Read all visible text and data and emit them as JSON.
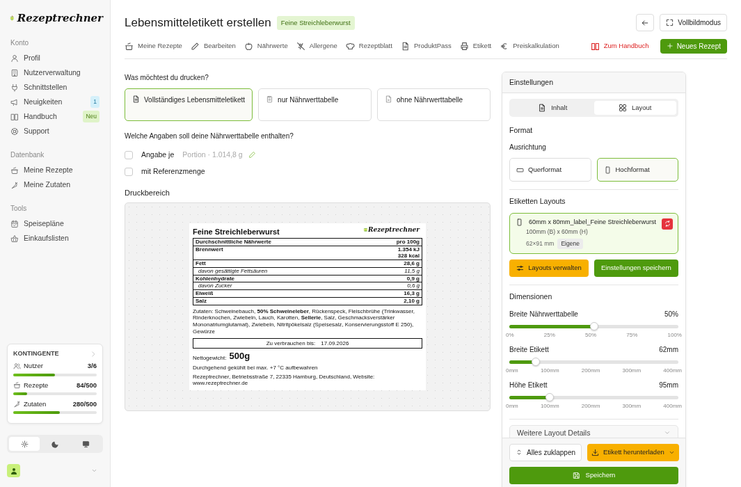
{
  "logo": {
    "name": "Rezeptrechner"
  },
  "sidebar": {
    "sections": [
      {
        "title": "Konto",
        "items": [
          {
            "label": "Profil"
          },
          {
            "label": "Nutzerverwaltung"
          },
          {
            "label": "Schnittstellen"
          },
          {
            "label": "Neuigkeiten",
            "badge": "1",
            "kind": "info"
          },
          {
            "label": "Handbuch",
            "badge": "Neu",
            "kind": "new"
          },
          {
            "label": "Support"
          }
        ]
      },
      {
        "title": "Datenbank",
        "items": [
          {
            "label": "Meine Rezepte"
          },
          {
            "label": "Meine Zutaten"
          }
        ]
      },
      {
        "title": "Tools",
        "items": [
          {
            "label": "Speisepläne"
          },
          {
            "label": "Einkaufslisten"
          }
        ]
      }
    ]
  },
  "quota": {
    "title": "KONTINGENTE",
    "items": [
      {
        "label": "Nutzer",
        "value": "3/6",
        "level": 0.5
      },
      {
        "label": "Rezepte",
        "value": "84/500",
        "level": 0.168
      },
      {
        "label": "Zutaten",
        "value": "280/500",
        "level": 0.56
      }
    ]
  },
  "theme_switch": [
    {
      "kind": "light",
      "selected": true
    },
    {
      "kind": "dark",
      "selected": false
    },
    {
      "kind": "system",
      "selected": false
    }
  ],
  "header": {
    "title": "Lebensmitteletikett erstellen",
    "tag": "Feine Streichleberwurst",
    "fullscreen_button": "Vollbildmodus"
  },
  "nav": {
    "items": [
      {
        "label": "Meine Rezepte"
      },
      {
        "label": "Bearbeiten"
      },
      {
        "label": "Nährwerte"
      },
      {
        "label": "Allergene"
      },
      {
        "label": "Rezeptblatt"
      },
      {
        "label": "ProduktPass"
      },
      {
        "label": "Etikett"
      },
      {
        "label": "Preiskalkulation"
      }
    ],
    "handbook_link": "Zum Handbuch",
    "new_button": "Neues Rezept"
  },
  "print_options": {
    "question": "Was möchtest du drucken?",
    "options": [
      {
        "label": "Vollständiges Lebensmitteletikett",
        "selected": true
      },
      {
        "label": "nur Nährwerttabelle",
        "selected": false
      },
      {
        "label": "ohne Nährwerttabelle",
        "selected": false
      }
    ]
  },
  "nutrition_options": {
    "question": "Welche Angaben soll deine Nährwerttabelle enthalten?",
    "checks": [
      {
        "label": "Angabe je",
        "detail": "Portion · 1.014,8 g",
        "checked": false
      },
      {
        "label": "mit Referenzmenge",
        "checked": false
      }
    ]
  },
  "print_area": {
    "title": "Druckbereich",
    "label": {
      "title": "Feine Streichleberwurst",
      "brand": "Rezeptrechner",
      "table_head": [
        "Durchschnittliche Nährwerte",
        "pro 100g"
      ],
      "rows": [
        {
          "name": "Brennwert",
          "values": [
            "1.354 kJ",
            "328 kcal"
          ],
          "kind": "main"
        },
        {
          "name": "Fett",
          "values": [
            "28,6 g"
          ],
          "kind": "main"
        },
        {
          "name": "davon gesättigte Fettsäuren",
          "values": [
            "11,5 g"
          ],
          "kind": "sub"
        },
        {
          "name": "Kohlenhydrate",
          "values": [
            "0,9 g"
          ],
          "kind": "main"
        },
        {
          "name": "davon Zucker",
          "values": [
            "0,6 g"
          ],
          "kind": "sub"
        },
        {
          "name": "Eiweiß",
          "values": [
            "16,3 g"
          ],
          "kind": "main"
        },
        {
          "name": "Salz",
          "values": [
            "2,10 g"
          ],
          "kind": "main"
        }
      ],
      "ingredients": "Zutaten: Schweinebauch, **50% Schweineleber**, Rückenspeck, Fleischbrühe (Trinkwasser, Rinderknochen, Zwiebeln, Lauch, Karotten, **Sellerie**, Salz, Geschmacksverstärker Mononatriumglutamat), Zwiebeln, Nitritpökelsalz (Speisesalz, Konservierungsstoff E 250), Gewürze",
      "best_before_label": "Zu verbrauchen bis:",
      "best_before": "17.09.2026",
      "net_label": "Nettogewicht:",
      "net_value": "500g",
      "storage": "Durchgehend gekühlt bei max. +7 °C aufbewahren",
      "address": "Rezeptrechner, Betriebsstraße 7, 22335 Hamburg, Deutschland, Website: www.rezeptrechner.de"
    }
  },
  "settings": {
    "title": "Einstellungen",
    "tabs": [
      {
        "label": "Inhalt",
        "selected": false
      },
      {
        "label": "Layout",
        "selected": true
      }
    ],
    "format_title": "Format",
    "orientation_label": "Ausrichtung",
    "orientations": [
      {
        "label": "Querformat",
        "selected": false
      },
      {
        "label": "Hochformat",
        "selected": true
      }
    ],
    "layouts_title": "Etiketten Layouts",
    "layouts": [
      {
        "name": "60mm x 80mm_label_Feine Streichleberwurst",
        "size": "100mm (B) x 60mm (H)",
        "dims": "62×91 mm",
        "tag": "Eigene",
        "selected": true
      }
    ],
    "manage_button": "Layouts verwalten",
    "save_settings_button": "Einstellungen speichern",
    "dimensions_title": "Dimensionen",
    "sliders": [
      {
        "label": "Breite Nährwerttabelle",
        "reading": "50%",
        "level": 0.5,
        "ticks": [
          "0%",
          "25%",
          "50%",
          "75%",
          "100%"
        ]
      },
      {
        "label": "Breite Etikett",
        "reading": "62mm",
        "level": 0.155,
        "ticks": [
          "0mm",
          "100mm",
          "200mm",
          "300mm",
          "400mm"
        ]
      },
      {
        "label": "Höhe Etikett",
        "reading": "95mm",
        "level": 0.2375,
        "ticks": [
          "0mm",
          "100mm",
          "200mm",
          "300mm",
          "400mm"
        ]
      }
    ],
    "details_accordion": {
      "label": "Weitere Layout Details",
      "expanded": false
    },
    "collapse_button": "Alles zuklappen",
    "download_button": "Etikett herunterladen",
    "save_button": "Speichern"
  }
}
